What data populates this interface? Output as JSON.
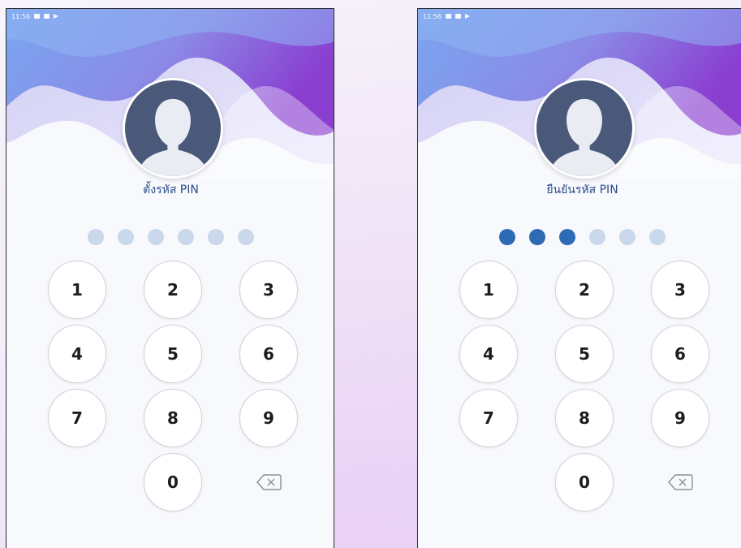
{
  "screens": [
    {
      "status_time": "11:56",
      "title": "ตั้งรหัส PIN",
      "pin": {
        "length": 6,
        "entered": 0
      },
      "keys": [
        "1",
        "2",
        "3",
        "4",
        "5",
        "6",
        "7",
        "8",
        "9",
        "0"
      ],
      "backspace_icon": "backspace-icon"
    },
    {
      "status_time": "11:56",
      "title": "ยืนยันรหัส PIN",
      "pin": {
        "length": 6,
        "entered": 3
      },
      "keys": [
        "1",
        "2",
        "3",
        "4",
        "5",
        "6",
        "7",
        "8",
        "9",
        "0"
      ],
      "backspace_icon": "backspace-icon"
    }
  ],
  "colors": {
    "accent": "#2e6bb5",
    "title": "#2d4e8c",
    "dot_empty": "#c9d8ea",
    "wave_purple": "#8a3fd1",
    "wave_blue": "#7b9ef0",
    "avatar": "#4a587a"
  }
}
